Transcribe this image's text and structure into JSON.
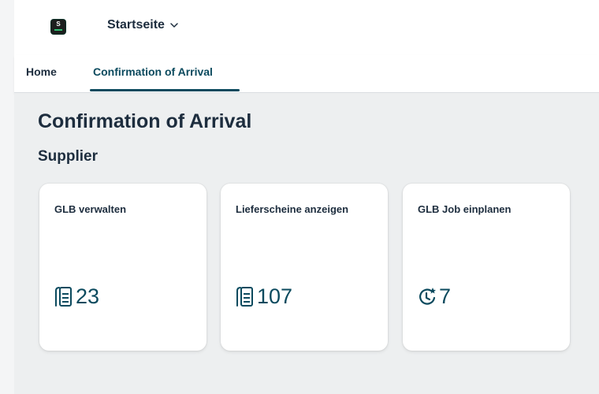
{
  "header": {
    "app_title": "Startseite"
  },
  "tabs": [
    {
      "label": "Home"
    },
    {
      "label": "Confirmation of Arrival"
    }
  ],
  "main": {
    "page_title": "Confirmation of Arrival",
    "section_title": "Supplier",
    "tiles": [
      {
        "title": "GLB verwalten",
        "value": "23",
        "icon": "document-stack-icon"
      },
      {
        "title": "Lieferscheine anzeigen",
        "value": "107",
        "icon": "document-stack-icon"
      },
      {
        "title": "GLB Job einplanen",
        "value": "7",
        "icon": "clock-star-icon"
      }
    ]
  },
  "colors": {
    "accent": "#0b4a5e",
    "text": "#1d2d3e",
    "content_bg": "#edeff0",
    "tile_bg": "#ffffff"
  }
}
